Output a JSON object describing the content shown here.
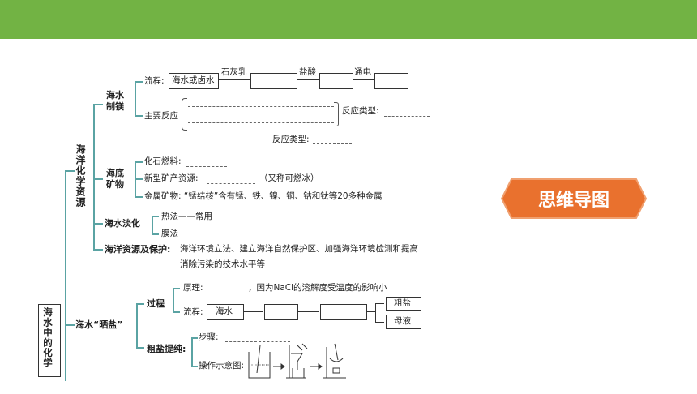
{
  "mindmap": {
    "root": "海水中的化学",
    "resources": {
      "title": "海洋化学资源",
      "magnesium": {
        "title": "海水制镁",
        "process_label": "流程:",
        "start_box": "海水或卤水",
        "reagent1": "石灰乳",
        "reagent2": "盐酸",
        "reagent3": "通电",
        "reaction_label": "主要反应",
        "reaction_type": "反应类型:"
      },
      "minerals": {
        "title": "海底矿物",
        "fossil_fuel": "化石燃料:",
        "new_mineral": "新型矿产资源:",
        "new_mineral_note": "（又称可燃冰）",
        "metal": "金属矿物: “锰结核”含有锰、铁、镍、铜、钴和钛等20多种金属"
      },
      "desalination": {
        "title": "海水淡化",
        "thermal": "热法——常用",
        "membrane": "膜法"
      },
      "protection": {
        "title": "海洋资源及保护:",
        "text_line1": "海洋环境立法、建立海洋自然保护区、加强海洋环境检测和提高",
        "text_line2": "消除污染的技术水平等"
      }
    },
    "salt": {
      "title": "海水“晒盐”",
      "process": {
        "title": "过程",
        "principle_label": "原理:",
        "principle_text": "，因为NaCl的溶解度受温度的影响小",
        "flow_label": "流程:",
        "flow_start": "海水",
        "crude_salt": "粗盐",
        "mother_liquor": "母液"
      },
      "purification": {
        "title": "粗盐提纯:",
        "steps_label": "步骤:",
        "diagram_label": "操作示意图:"
      }
    }
  },
  "badge": {
    "label": "思维导图"
  },
  "colors": {
    "topbar": "#72b344",
    "badge": "#e9712e",
    "connector": "#5aa3a3"
  }
}
